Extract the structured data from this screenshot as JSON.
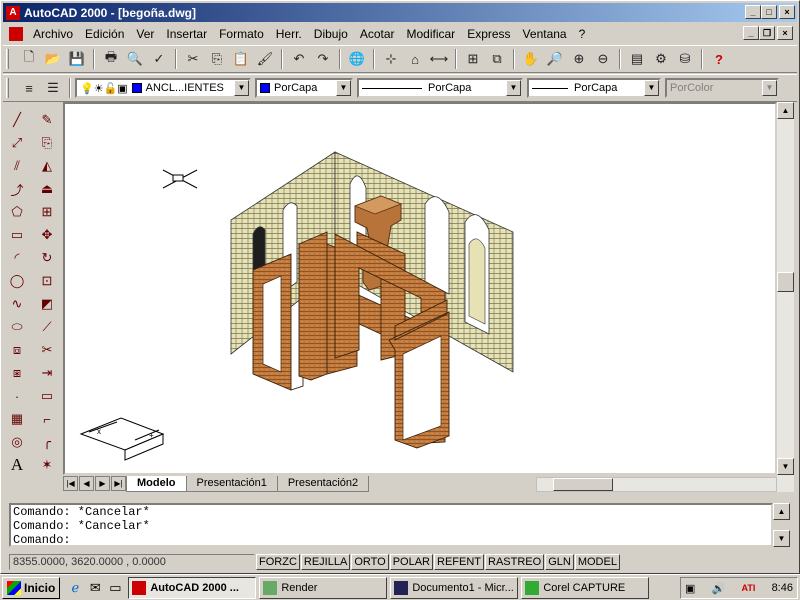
{
  "window": {
    "title": "AutoCAD 2000 - [begoña.dwg]"
  },
  "menu": {
    "items": [
      "Archivo",
      "Edición",
      "Ver",
      "Insertar",
      "Formato",
      "Herr.",
      "Dibujo",
      "Acotar",
      "Modificar",
      "Express",
      "Ventana",
      "?"
    ]
  },
  "properties": {
    "layer": "ANCL...IENTES",
    "color": "PorCapa",
    "linetype": "PorCapa",
    "lineweight": "PorCapa",
    "plotstyle": "PorColor"
  },
  "tabs": {
    "model": "Modelo",
    "layout1": "Presentación1",
    "layout2": "Presentación2"
  },
  "command": {
    "line1": "Comando: *Cancelar*",
    "line2": "Comando: *Cancelar*",
    "line3": "Comando:"
  },
  "status": {
    "coords": "8355.0000, 3620.0000 , 0.0000",
    "toggles": [
      "FORZC",
      "REJILLA",
      "ORTO",
      "POLAR",
      "REFENT",
      "RASTREO",
      "GLN",
      "MODEL"
    ]
  },
  "taskbar": {
    "start": "Inicio",
    "tasks": [
      "AutoCAD 2000 ...",
      "Render",
      "Documento1 - Micr...",
      "Corel CAPTURE"
    ],
    "clock": "8:46"
  },
  "colors": {
    "title_start": "#0a246a",
    "title_end": "#a6caf0",
    "wall": "#e6e2b4",
    "frame": "#b8733a"
  }
}
